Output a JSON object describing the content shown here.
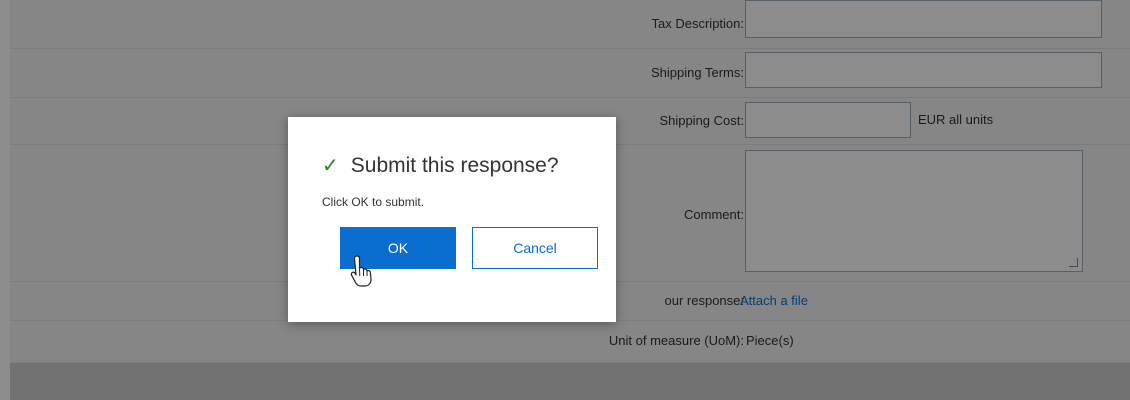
{
  "form": {
    "tax_description_label": "Tax Description:",
    "shipping_terms_label": "Shipping Terms:",
    "shipping_cost_label": "Shipping Cost:",
    "shipping_cost_unit": "EUR all units",
    "comment_label": "Comment:",
    "attach_label": "our response:",
    "attach_link": "Attach a file",
    "uom_label": "Unit of measure (UoM):",
    "uom_value": "Piece(s)"
  },
  "dialog": {
    "title": "Submit this response?",
    "message": "Click OK to submit.",
    "ok_label": "OK",
    "cancel_label": "Cancel",
    "icon": "checkmark-icon"
  },
  "colors": {
    "accent": "#0a6ed1",
    "success": "#2b7d2b"
  }
}
